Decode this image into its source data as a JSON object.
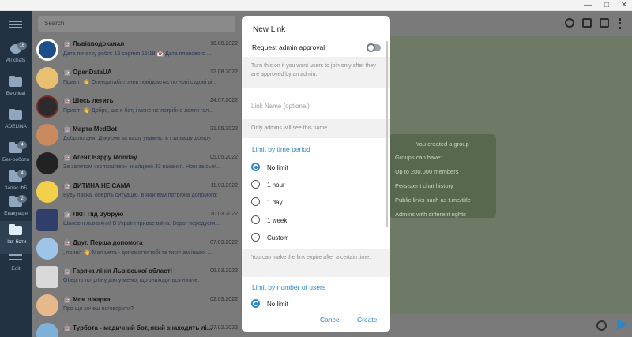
{
  "window": {
    "minimize": "—",
    "maximize": "□",
    "close": "✕"
  },
  "rail": {
    "items": [
      {
        "label": "All chats",
        "badge": "16"
      },
      {
        "label": "Веклієві",
        "badge": ""
      },
      {
        "label": "ADELINA",
        "badge": ""
      },
      {
        "label": "Без-роботи",
        "badge": "4"
      },
      {
        "label": "Запас ФБ",
        "badge": "4"
      },
      {
        "label": "Евакуація",
        "badge": "2"
      },
      {
        "label": "Чат-боти",
        "badge": ""
      },
      {
        "label": "Edit",
        "badge": ""
      }
    ]
  },
  "search": {
    "placeholder": "Search"
  },
  "chats": [
    {
      "name": "🤖 Львівводоканал",
      "date": "16.08.2022",
      "preview": "Дата початку робіт: 16 серпня 15:18 📆 Дата планового ..."
    },
    {
      "name": "🤖 OpenDataUA",
      "date": "12.08.2022",
      "preview": "Привіт! 👋 Опендатабот знов повідомляє по нові судові рі..."
    },
    {
      "name": "🤖 Шось летить",
      "date": "24.07.2022",
      "preview": "Привіт! 👋 Добре, що я бот, і мене не потрібно лаяти гол..."
    },
    {
      "name": "🤖 Марта MedBot",
      "date": "21.05.2022",
      "preview": "Доброго дня! Дякуємо за вашу уважність і за вашу довіру."
    },
    {
      "name": "🤖 Агент Happy Monday",
      "date": "05.05.2022",
      "preview": "За запитом «копірайтер» знайдено 33 вакансії. Нові за сьог..."
    },
    {
      "name": "🤖 ДИТИНА НЕ САМА",
      "date": "11.03.2022",
      "preview": "Будь ласка, оберіть ситуацію, в якій вам потрібна допомога:"
    },
    {
      "name": "🤖 ЛКП Під Зубрую",
      "date": "10.03.2022",
      "preview": "Шановні львів'яни! В Україні триває війна. Ворог передусім..."
    },
    {
      "name": "🤖 Друг. Перша допомога",
      "date": "07.03.2022",
      "preview": ", привіт 👋 Моя мета - допомогти тобі та тисячам інших ..."
    },
    {
      "name": "🤖 Гаряча лінія Львівської області",
      "date": "06.03.2022",
      "preview": "Оберіть потрібну дію у меню, що знаходиться нижче."
    },
    {
      "name": "🤖 Моя лікарка",
      "date": "02.03.2022",
      "preview": "Про що хочеш поговорити?"
    },
    {
      "name": "🤖 Турбота - медичний бот, який знаходить лі...",
      "date": "27.02.2022",
      "preview": ""
    }
  ],
  "group_info": {
    "title": "You created a group",
    "subtitle": "Groups can have:",
    "lines": [
      "Up to 200,000 members",
      "Persistent chat history",
      "Public links such as t.me/title",
      "Admins with different rights"
    ]
  },
  "modal": {
    "title": "New Link",
    "approval_label": "Request admin approval",
    "approval_on": false,
    "approval_hint": "Turn this on if you want users to join only after they are approved by an admin.",
    "name_placeholder": "Link Name (optional)",
    "name_hint": "Only admins will see this name.",
    "time_section": "Limit by time period",
    "time_options": [
      "No limit",
      "1 hour",
      "1 day",
      "1 week",
      "Custom"
    ],
    "time_selected": "No limit",
    "time_hint": "You can make the link expire after a certain time.",
    "users_section": "Limit by number of users",
    "users_selected": "No limit",
    "cancel": "Cancel",
    "create": "Create",
    "accent": "#2e86c8"
  }
}
